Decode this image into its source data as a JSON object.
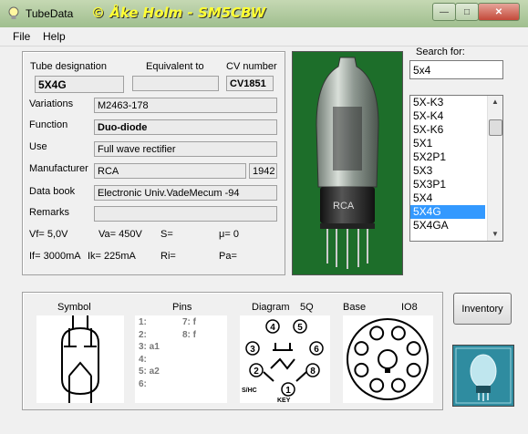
{
  "window": {
    "title": "TubeData",
    "author": "© Åke Holm - SM5CBW",
    "min_glyph": "—",
    "max_glyph": "□",
    "close_glyph": "✕"
  },
  "menu": {
    "file": "File",
    "help": "Help"
  },
  "labels": {
    "tube_designation": "Tube designation",
    "equivalent_to": "Equivalent to",
    "cv_number": "CV number",
    "variations": "Variations",
    "function": "Function",
    "use": "Use",
    "manufacturer": "Manufacturer",
    "data_book": "Data book",
    "remarks": "Remarks"
  },
  "values": {
    "tube_designation": "5X4G",
    "equivalent_to": "",
    "cv_number": "CV1851",
    "variations": "M2463-178",
    "function": "Duo-diode",
    "use": "Full wave rectifier",
    "manufacturer": "RCA",
    "year": "1942",
    "data_book": "Electronic Univ.VadeMecum -94",
    "remarks": ""
  },
  "electrical": {
    "vf": "Vf= 5,0V",
    "va": "Va=  450V",
    "s": "S=",
    "mu": "μ=    0",
    "if": "If= 3000mA",
    "ik": "Ik=   225mA",
    "ri": "Ri=",
    "pa": "Pa="
  },
  "photo_text": "RCA",
  "search": {
    "label": "Search for:",
    "value": "5x4"
  },
  "results": [
    "5X-K3",
    "5X-K4",
    "5X-K6",
    "5X1",
    "5X2P1",
    "5X3",
    "5X3P1",
    "5X4",
    "5X4G",
    "5X4GA"
  ],
  "selected_index": 8,
  "bottom": {
    "symbol_label": "Symbol",
    "pins_label": "Pins",
    "diagram_label": "Diagram",
    "diagram_code": "5Q",
    "base_label": "Base",
    "base_code": "IO8",
    "pins_left": [
      "1:",
      "2:",
      "3: a1",
      "4:",
      "5: a2",
      "6:"
    ],
    "pins_right": [
      "7: f",
      "8: f"
    ],
    "diagram_pin_numbers": [
      "1",
      "2",
      "3",
      "4",
      "5",
      "6",
      "8"
    ],
    "diagram_sub": "S/HC",
    "diagram_key": "KEY"
  },
  "inventory_button": "Inventory",
  "colors": {
    "title_text": "#ffff33",
    "selection": "#3399ff",
    "photo_bg": "#1d6e2a",
    "logo_bg": "#2f8ca0"
  }
}
